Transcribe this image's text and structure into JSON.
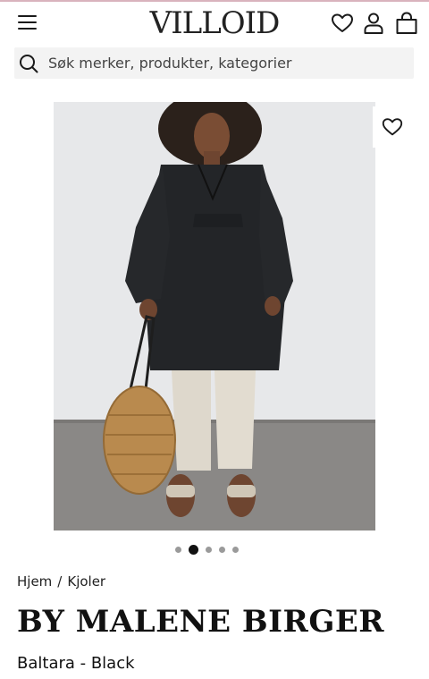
{
  "header": {
    "logo": "VILLOID",
    "menu_icon": "hamburger-menu-icon",
    "wishlist_icon": "heart-icon",
    "account_icon": "user-icon",
    "cart_icon": "shopping-bag-icon"
  },
  "search": {
    "placeholder": "Søk merker, produkter, kategorier",
    "value": "",
    "icon": "search-icon"
  },
  "gallery": {
    "favorite_icon": "heart-icon",
    "image_count": 5,
    "active_index": 1
  },
  "breadcrumb": {
    "home": "Hjem",
    "separator": "/",
    "category": "Kjoler"
  },
  "product": {
    "brand": "BY MALENE BIRGER",
    "name": "Baltara - Black"
  },
  "colors": {
    "accent_line": "#d9b3bd",
    "text": "#1a1a1a",
    "search_bg": "#f3f3f3"
  }
}
